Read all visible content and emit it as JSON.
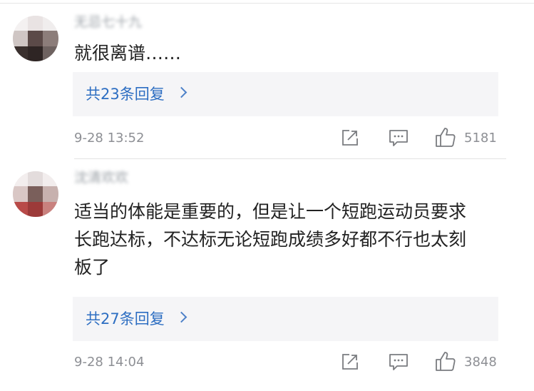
{
  "comments": [
    {
      "username": "无忌七十九",
      "text": "就很离谱……",
      "replies_label": "共23条回复",
      "time": "9-28 13:52",
      "likes": "5181"
    },
    {
      "username": "沈清欢欢",
      "text_lines": [
        "适当的体能是重要的，但是让一个短跑运动员要求",
        "长跑达标，不达标无论短跑成绩多好都不行也太刻",
        "板了"
      ],
      "replies_label": "共27条回复",
      "time": "9-28 14:04",
      "likes": "3848"
    }
  ],
  "icons": [
    "share-icon",
    "comment-icon",
    "like-icon",
    "chevron-right-icon"
  ],
  "colors": {
    "link": "#2d6ec2",
    "meta": "#8d8f94",
    "reply_bg": "#f5f5f7"
  }
}
